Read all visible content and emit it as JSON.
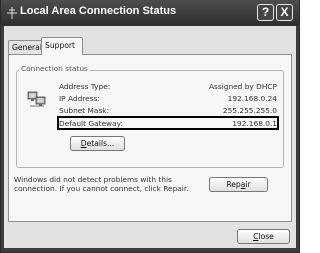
{
  "window": {
    "title": "Local Area Connection Status",
    "help_label": "?",
    "close_label": "X"
  },
  "tabs": [
    {
      "label": "General",
      "active": false
    },
    {
      "label": "Support",
      "active": true
    }
  ],
  "connection_status": {
    "group_label": "Connection status",
    "icon": "network-connection-icon",
    "rows": [
      {
        "label": "Address Type:",
        "value": "Assigned by DHCP"
      },
      {
        "label": "IP Address:",
        "value": "192.168.0.24"
      },
      {
        "label": "Subnet Mask:",
        "value": "255.255.255.0"
      },
      {
        "label": "Default Gateway:",
        "value": "192.168.0.1",
        "highlighted": true
      }
    ],
    "details_button": {
      "pre": "",
      "accel": "D",
      "post": "etails..."
    }
  },
  "repair": {
    "message": "Windows did not detect problems with this connection. If you cannot connect, click Repair.",
    "button": {
      "pre": "Rep",
      "accel": "a",
      "post": "ir"
    }
  },
  "close_button": {
    "pre": "",
    "accel": "C",
    "post": "lose"
  }
}
